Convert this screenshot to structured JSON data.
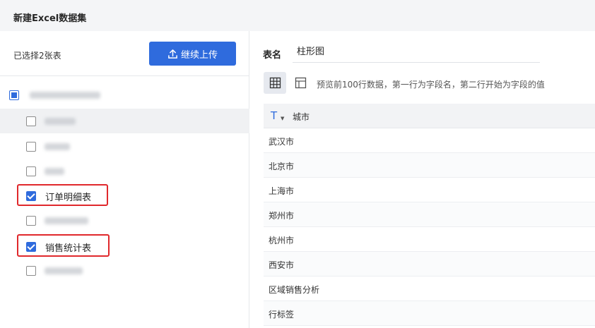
{
  "header": {
    "title": "新建Excel数据集"
  },
  "left": {
    "selected_count": "已选择2张表",
    "upload_label": "继续上传",
    "file_checkbox_state": "partial",
    "sheets": [
      {
        "label": "",
        "checked": false
      },
      {
        "label": "",
        "checked": false
      },
      {
        "label": "",
        "checked": false
      },
      {
        "label": "订单明细表",
        "checked": true
      },
      {
        "label": "",
        "checked": false
      },
      {
        "label": "销售统计表",
        "checked": true
      },
      {
        "label": "",
        "checked": false
      }
    ],
    "highlight_color": "#e0282c"
  },
  "right": {
    "table_name_label": "表名",
    "table_name_value": "柱形图",
    "preview_hint": "预览前100行数据，第一行为字段名，第二行开始为字段的值",
    "column": {
      "type_icon": "text-type-icon",
      "name": "城市"
    },
    "rows": [
      "武汉市",
      "北京市",
      "上海市",
      "郑州市",
      "杭州市",
      "西安市",
      "区域销售分析",
      "行标签"
    ]
  },
  "colors": {
    "primary": "#2f6bdd",
    "header_bg": "#f4f5f7"
  }
}
